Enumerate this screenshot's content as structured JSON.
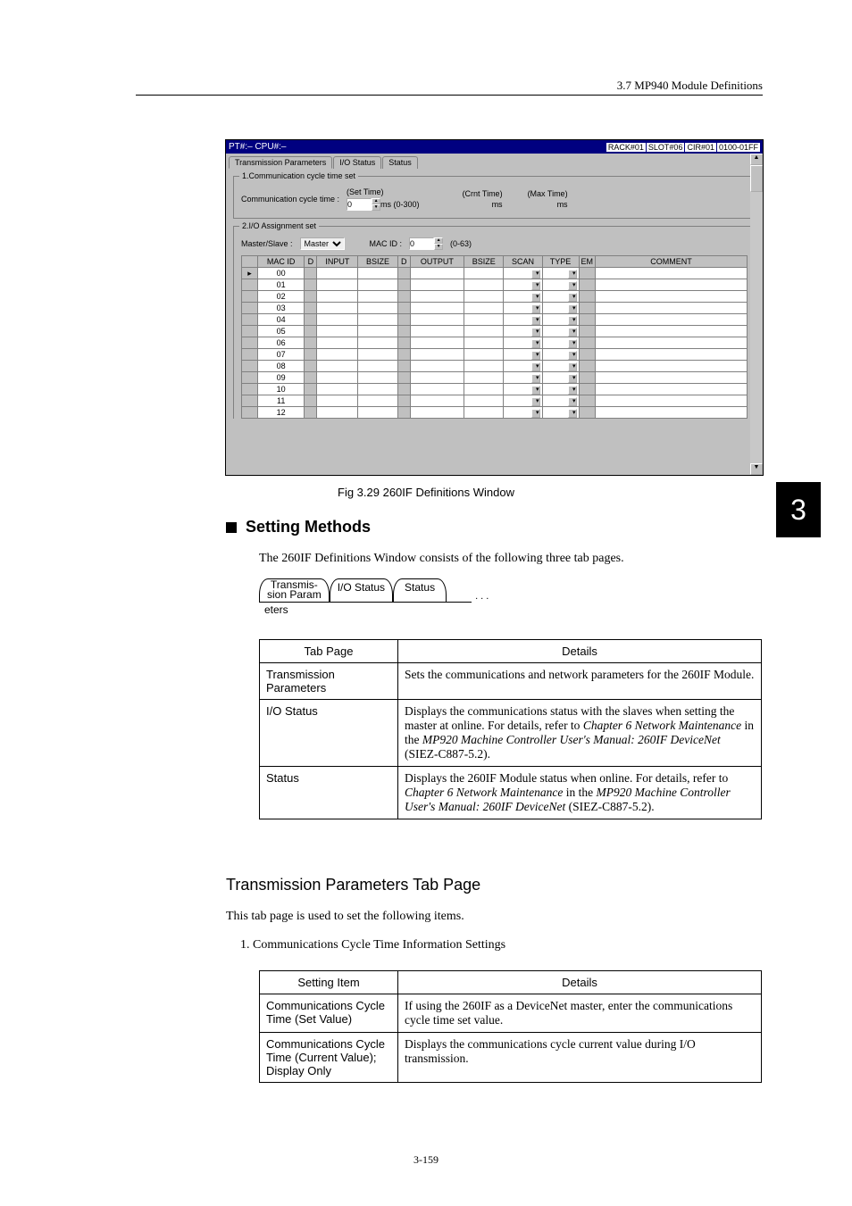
{
  "header": {
    "breadcrumb": "3.7  MP940 Module Definitions"
  },
  "page_indicator": "3",
  "screenshot": {
    "title_left": "PT#:– CPU#:–",
    "title_right": [
      "RACK#01",
      "SLOT#06",
      "CIR#01",
      "0100-01FF"
    ],
    "tabs": [
      "Transmission Parameters",
      "I/O Status",
      "Status"
    ],
    "group1": {
      "title": "1.Communication cycle time set",
      "label": "Communication cycle time :",
      "set_time_label": "(Set Time)",
      "set_value": "0",
      "set_unit": "ms (0-300)",
      "crnt_label": "(Crnt Time)",
      "crnt_unit": "ms",
      "max_label": "(Max Time)",
      "max_unit": "ms"
    },
    "group2": {
      "title": "2.I/O Assignment set",
      "master_label": "Master/Slave :",
      "master_value": "Master",
      "macid_label": "MAC ID :",
      "macid_value": "0",
      "macid_range": "(0-63)"
    },
    "grid": {
      "headers": [
        "",
        "MAC ID",
        "D",
        "INPUT",
        "BSIZE",
        "D",
        "OUTPUT",
        "BSIZE",
        "SCAN",
        "TYPE",
        "EM",
        "COMMENT"
      ],
      "rows": [
        "00",
        "01",
        "02",
        "03",
        "04",
        "05",
        "06",
        "07",
        "08",
        "09",
        "10",
        "11",
        "12"
      ]
    }
  },
  "fig_caption": "Fig 3.29  260IF Definitions Window",
  "section1": {
    "heading": "Setting Methods",
    "para": "The 260IF Definitions Window consists of the following three tab pages.",
    "tabs": {
      "t1a": "Transmis-",
      "t1b": "sion Param",
      "t1c": "eters",
      "t2": "I/O Status",
      "t3": "Status",
      "dots": ". . ."
    }
  },
  "table1": {
    "h1": "Tab Page",
    "h2": "Details",
    "r1c1": "Transmission Parameters",
    "r1c2": "Sets the communications and network parameters for the 260IF Module.",
    "r2c1": "I/O Status",
    "r2c2a": "Displays the communications status with the slaves when setting the master at online. For details, refer to ",
    "r2c2b": "Chapter 6 Network Maintenance",
    "r2c2c": " in the ",
    "r2c2d": "MP920 Machine Controller User's Manual: 260IF DeviceNet",
    "r2c2e": " (SIEZ-C887-5.2).",
    "r3c1": "Status",
    "r3c2a": "Displays the 260IF Module status when online. For details, refer to ",
    "r3c2b": "Chapter 6 Network Maintenance",
    "r3c2c": " in the ",
    "r3c2d": "MP920 Machine Controller User's Manual: 260IF DeviceNet",
    "r3c2e": " (SIEZ-C887-5.2)."
  },
  "section2": {
    "heading": "Transmission Parameters Tab Page",
    "para": "This tab page is used to set the following items.",
    "list1": "1.  Communications Cycle Time Information Settings"
  },
  "table2": {
    "h1": "Setting Item",
    "h2": "Details",
    "r1c1": "Communications Cycle Time (Set Value)",
    "r1c2": "If using the 260IF as a DeviceNet master, enter the communications cycle time set value.",
    "r2c1": "Communications Cycle Time (Current Value); Display Only",
    "r2c2": "Displays the communications cycle current value during I/O transmission."
  },
  "footer": {
    "page_number": "3-159"
  }
}
